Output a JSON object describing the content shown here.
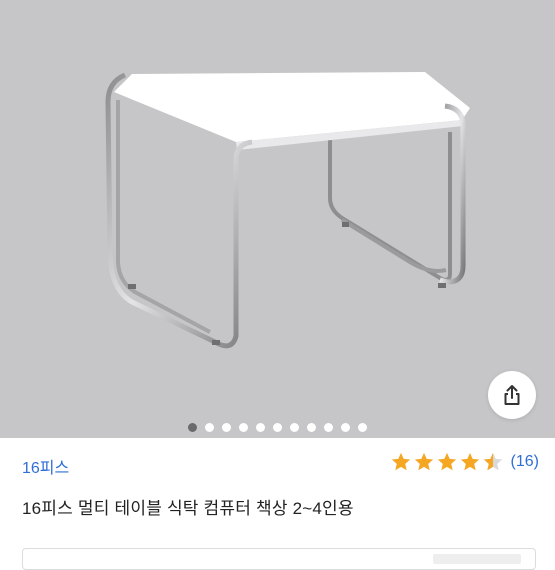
{
  "gallery": {
    "image": "table-photo",
    "total_slides": 11,
    "active_slide": 1,
    "share_icon": "share-icon",
    "background_color": "#c6c6c8"
  },
  "product": {
    "brand": "16피스",
    "title": "16피스 멀티 테이블 식탁 컴퓨터 책상 2~4인용",
    "rating": {
      "stars": 4.5,
      "max_stars": 5,
      "review_count": "(16)",
      "star_color": "#f5a623"
    },
    "link_color": "#2f6fd6"
  }
}
